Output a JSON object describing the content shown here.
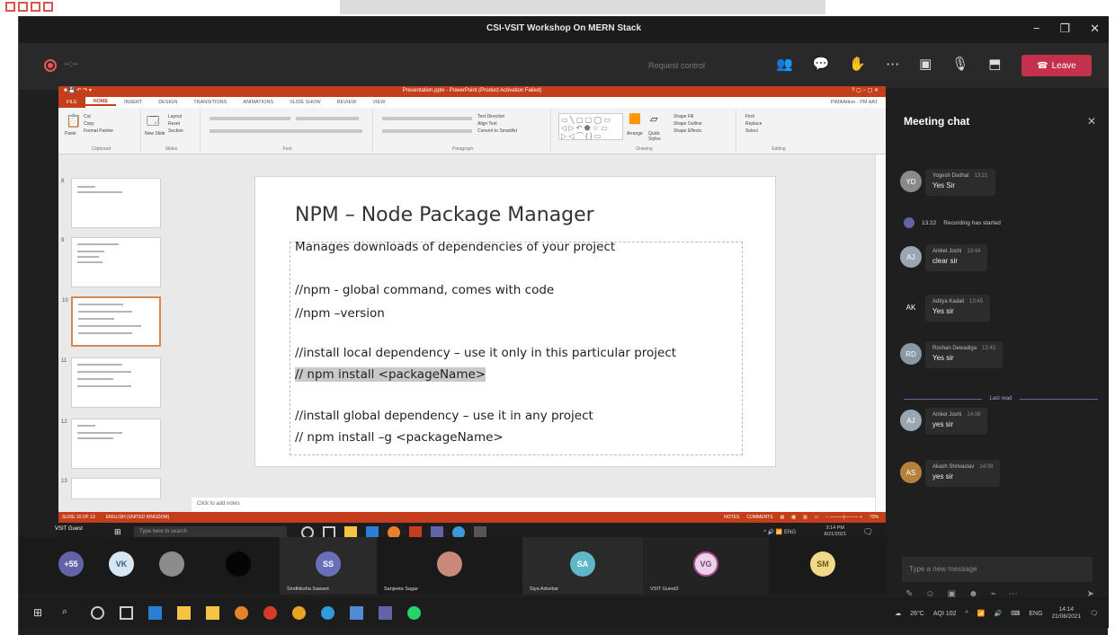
{
  "window": {
    "title": "CSI-VSIT Workshop On MERN Stack"
  },
  "meeting_toolbar": {
    "timer": "--:--",
    "request_control": "Request control",
    "leave_label": "Leave"
  },
  "powerpoint": {
    "title": "Presentation.pptx - PowerPoint (Product Activation Failed)",
    "tabs": [
      "FILE",
      "HOME",
      "INSERT",
      "DESIGN",
      "TRANSITIONS",
      "ANIMATIONS",
      "SLIDE SHOW",
      "REVIEW",
      "VIEW"
    ],
    "user": "PIMAAttion - PM AAT",
    "ribbon_groups": [
      "Clipboard",
      "Slides",
      "Font",
      "Paragraph",
      "Drawing",
      "Editing"
    ],
    "ribbon_buttons": {
      "cut": "Cut",
      "copy": "Copy",
      "format_painter": "Format Painter",
      "paste": "Paste",
      "new_slide": "New Slide",
      "layout": "Layout",
      "reset": "Reset",
      "section": "Section",
      "arrange": "Arrange",
      "quick_styles": "Quick Styles",
      "shape_fill": "Shape Fill",
      "shape_outline": "Shape Outline",
      "shape_effects": "Shape Effects",
      "find": "Find",
      "replace": "Replace",
      "select": "Select",
      "text_direction": "Text Direction",
      "align_text": "Align Text",
      "convert_smartart": "Convert to SmartArt"
    },
    "thumb_numbers": [
      "8",
      "9",
      "10",
      "11",
      "12",
      "13"
    ],
    "slide": {
      "title": "NPM – Node Package Manager",
      "lines": [
        "Manages downloads of dependencies of your project",
        "//npm  - global command, comes with code",
        "//npm –version",
        "//install local dependency – use it only in this particular project",
        "// npm install <packageName>",
        "//install global dependency – use it in any project",
        "// npm install –g <packageName>"
      ]
    },
    "notes_placeholder": "Click to add notes",
    "status": {
      "slide_count": "SLIDE 10 OF 13",
      "language": "ENGLISH (UNITED KINGDOM)",
      "notes": "NOTES",
      "comments": "COMMENTS",
      "zoom": "73%"
    }
  },
  "presenter_taskbar": {
    "presenter": "VSIT Guest",
    "search_placeholder": "Type here to search",
    "lang": "ENG",
    "time": "3:14 PM",
    "date": "8/21/2021"
  },
  "chat": {
    "header": "Meeting chat",
    "messages": [
      {
        "initials": "YD",
        "author": "Yogesh Dudhal",
        "time": "13:21",
        "text": "Yes Sir",
        "color": "#8a8a8a"
      },
      {
        "initials": "AJ",
        "author": "Aniket Joshi",
        "time": "13:44",
        "text": "clear sir",
        "color": "#9aa6b2"
      },
      {
        "initials": "AK",
        "author": "Aditya Kadali",
        "time": "13:45",
        "text": "Yes sir",
        "color": "#1e1e1e"
      },
      {
        "initials": "RD",
        "author": "Roshan Dewadiga",
        "time": "13:45",
        "text": "Yes sir",
        "color": "#8899a6"
      },
      {
        "initials": "AJ",
        "author": "Aniket Joshi",
        "time": "14:08",
        "text": "yes sir",
        "color": "#9aa6b2"
      },
      {
        "initials": "AS",
        "author": "Akash Shrivastav",
        "time": "14:09",
        "text": "yes sir",
        "color": "#b7813d"
      }
    ],
    "system": {
      "time": "13:22",
      "text": "Recording has started"
    },
    "last_read": "Last read",
    "compose_placeholder": "Type a new message"
  },
  "gallery": [
    {
      "initials": "+55",
      "name": "",
      "bg": "#6264a7",
      "fg": "#ffffff"
    },
    {
      "initials": "VK",
      "name": "",
      "bg": "#d6e6f2",
      "fg": "#3b5a78"
    },
    {
      "initials": "",
      "name": "",
      "bg": "#8c8c8c",
      "fg": "#ffffff"
    },
    {
      "initials": "",
      "name": "",
      "bg": "#050505",
      "fg": "#ffffff"
    },
    {
      "initials": "SS",
      "name": "Sindhiksha Sawant",
      "bg": "#6a70b8",
      "fg": "#ffffff"
    },
    {
      "initials": "",
      "name": "Sanjeeta Sagar",
      "bg": "#c98a7a",
      "fg": "#ffffff"
    },
    {
      "initials": "SA",
      "name": "Siya Advekar",
      "bg": "#5fb7c9",
      "fg": "#ffffff"
    },
    {
      "initials": "VG",
      "name": "VSIT Guest3",
      "bg": "#e8d4e6",
      "fg": "#8a3a78"
    },
    {
      "initials": "SM",
      "name": "",
      "bg": "#f2d98a",
      "fg": "#6b5411"
    }
  ],
  "os_taskbar": {
    "weather": "26°C",
    "aqi": "AQI 102",
    "lang": "ENG",
    "time": "14:14",
    "date": "21/08/2021"
  }
}
